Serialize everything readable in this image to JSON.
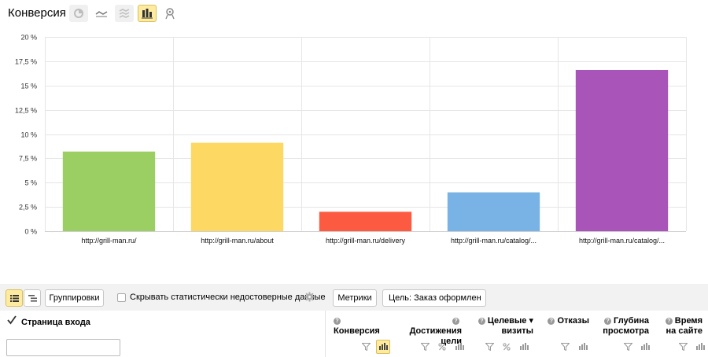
{
  "header": {
    "title": "Конверсия",
    "chart_types": [
      {
        "name": "pie-chart",
        "state": "disabled"
      },
      {
        "name": "line-chart",
        "state": "normal"
      },
      {
        "name": "area-chart",
        "state": "disabled"
      },
      {
        "name": "bar-chart",
        "state": "active"
      },
      {
        "name": "map-marker",
        "state": "normal"
      }
    ]
  },
  "chart_data": {
    "type": "bar",
    "categories": [
      "http://grill-man.ru/",
      "http://grill-man.ru/about",
      "http://grill-man.ru/delivery",
      "http://grill-man.ru/catalog/...",
      "http://grill-man.ru/catalog/..."
    ],
    "values": [
      8.2,
      9.1,
      2.0,
      4.0,
      16.6
    ],
    "colors": [
      "#9ccf63",
      "#fdd862",
      "#fc5b41",
      "#79b3e5",
      "#a954b8"
    ],
    "ylim": [
      0,
      20
    ],
    "yticks": [
      0,
      2.5,
      5,
      7.5,
      10,
      12.5,
      15,
      17.5,
      20
    ],
    "ytick_labels": [
      "0 %",
      "2,5 %",
      "5 %",
      "7,5 %",
      "10 %",
      "12,5 %",
      "15 %",
      "17,5 %",
      "20 %"
    ],
    "grid": true,
    "title": "",
    "xlabel": "",
    "ylabel": ""
  },
  "toolbar": {
    "groupings_label": "Группировки",
    "hide_unreliable_label": "Скрывать статистически недостоверные данные",
    "metrics_label": "Метрики",
    "goal_label": "Цель: Заказ оформлен"
  },
  "dimension": {
    "label": "Страница входа",
    "filter_placeholder": ""
  },
  "columns": [
    {
      "line1": "Конверсия",
      "line2": ""
    },
    {
      "line1": "Достижения",
      "line2": "цели"
    },
    {
      "line1": "Целевые ▾",
      "line2": "визиты"
    },
    {
      "line1": "Отказы",
      "line2": ""
    },
    {
      "line1": "Глубина",
      "line2": "просмотра"
    },
    {
      "line1": "Время",
      "line2": "на сайте"
    }
  ]
}
